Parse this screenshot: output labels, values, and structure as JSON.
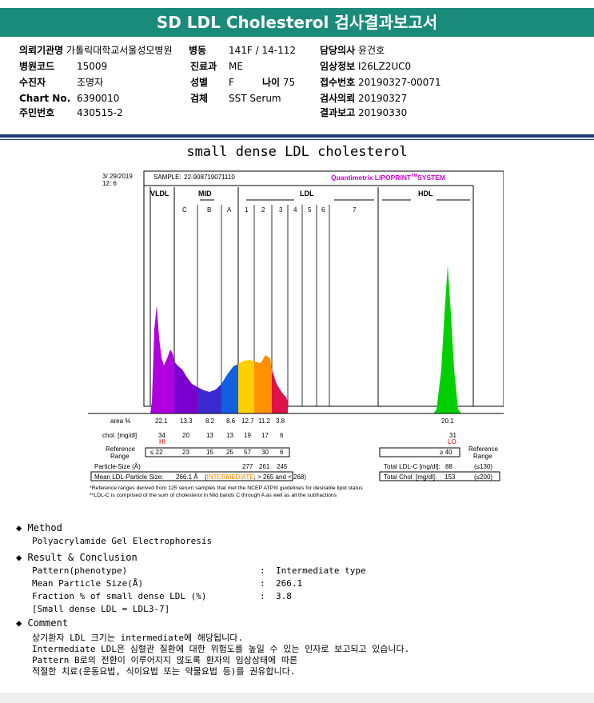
{
  "header": {
    "title": "SD LDL Cholesterol 검사결과보고서"
  },
  "patient_info": {
    "institution_label": "의뢰기관명",
    "institution": "가톨릭대학교서울성모병원",
    "ward_label": "병동",
    "ward": "141F / 14-112",
    "doctor_label": "담당의사",
    "doctor": "윤건호",
    "hospital_code_label": "병원코드",
    "hospital_code": "15009",
    "department_label": "진료과",
    "department": "ME",
    "clinical_label": "임상정보",
    "clinical": "I26LZ2UC0",
    "collector_label": "수진자",
    "collector": "조명자",
    "sex_label": "성별",
    "sex": "F",
    "age_label": "나이",
    "age": "75",
    "receipt_label": "접수번호",
    "receipt": "20190327-00071",
    "chart_label": "Chart No.",
    "chart": "6390010",
    "specimen_label": "검체",
    "specimen": "SST Serum",
    "request_label": "검사의뢰",
    "request": "20190327",
    "id_label": "주민번호",
    "id": "430515-2",
    "report_label": "결과보고",
    "report": "20190330"
  },
  "section_title": "small dense LDL cholesterol",
  "lipoprint": {
    "date": "3/ 29/2019",
    "time": "12: 6",
    "sample_label": "SAMPLE:",
    "sample": "22-908719071110",
    "brand": "Quantimetrix LIPOPRINT",
    "brand_tm": "TM",
    "brand_system": "SYSTEM",
    "groups": [
      "VLDL",
      "MID",
      "LDL",
      "HDL"
    ],
    "bands": [
      "C",
      "B",
      "A",
      "1",
      "2",
      "3",
      "4",
      "5",
      "6",
      "7"
    ],
    "row_area_label": "area %",
    "area": [
      "22.1",
      "13.3",
      "8.2",
      "8.6",
      "12.7",
      "11.2",
      "3.8",
      "20.1"
    ],
    "row_chol_label": "chol. [mg/dl]",
    "chol": [
      "34",
      "20",
      "13",
      "13",
      "19",
      "17",
      "6",
      "31"
    ],
    "flag_hi": "HI",
    "flag_lo": "LO",
    "ref_label_1": "Reference",
    "ref_label_2": "Range",
    "ref": [
      "≤ 22",
      "23",
      "15",
      "25",
      "57",
      "30",
      "6",
      "≥ 40"
    ],
    "particle_label": "Particle-Size (Å)",
    "particle": [
      "277",
      "261",
      "245"
    ],
    "total_ldl_label": "Total LDL-C [mg/dl]:",
    "total_ldl": "88",
    "total_ldl_ref": "(≤130)",
    "mean_label": "Mean LDL-Particle Size:",
    "mean_value": "266.1 Å",
    "mean_class": "INTERMEDIATE",
    "mean_criteria": "; > 265 and < 268)",
    "total_chol_label": "Total Chol. [mg/dl]:",
    "total_chol": "153",
    "total_chol_ref": "(≤200)",
    "note1": "*Reference ranges derived from 125 serum samples that met the NCEP ATPIII guidelines for desirable lipid status",
    "note2": "**LDL-C is comprised of the sum of cholesterol in Mid bands C through A as well as all the subfractions",
    "colors": {
      "vldl": "#b000e0",
      "c": "#7a00d0",
      "b": "#3a2ad0",
      "a": "#1060e0",
      "l1": "#ffd000",
      "l2": "#ff9000",
      "l3": "#e0104a",
      "hdl": "#00d000",
      "brand": "#d000d0",
      "flag": "#e00000",
      "intermediate": "#ff8800"
    }
  },
  "method": {
    "heading": "Method",
    "text": "Polyacrylamide Gel Electrophoresis"
  },
  "result": {
    "heading": "Result & Conclusion",
    "rows": [
      {
        "label": "Pattern(phenotype)",
        "value": "Intermediate type"
      },
      {
        "label": "Mean Particle Size(Å)",
        "value": "266.1"
      },
      {
        "label": "Fraction % of small dense LDL (%)",
        "value": "3.8"
      }
    ],
    "note": "[Small dense LDL = LDL3-7]"
  },
  "comment": {
    "heading": "Comment",
    "lines": [
      "상기환자 LDL 크기는 intermediate에 해당됩니다.",
      "Intermediate LDL은 심혈관 질환에 대한 위험도를 높일 수 있는 인자로 보고되고 있습니다.",
      "Pattern B로의 전환이 이루어지지 않도록 환자의 임상상태에 따른",
      "적절한 치료(운동요법, 식이요법 또는 약물요법 등)를 권유합니다."
    ]
  }
}
